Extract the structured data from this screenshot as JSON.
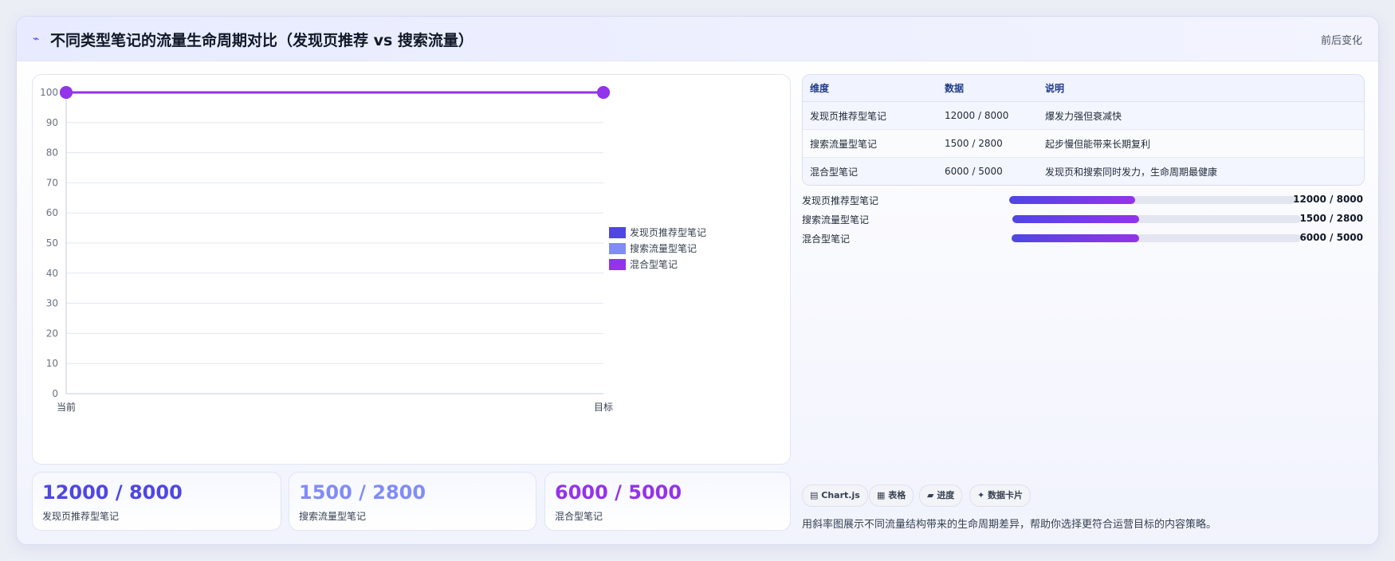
{
  "header": {
    "icon": "⌁",
    "title": "不同类型笔记的流量生命周期对比（发现页推荐 vs 搜索流量）",
    "right_label": "前后变化"
  },
  "chart_data": {
    "type": "line",
    "title": "",
    "x": [
      "当前",
      "目标"
    ],
    "ylim": [
      0,
      100
    ],
    "yticks": [
      0,
      10,
      20,
      30,
      40,
      50,
      60,
      70,
      80,
      90,
      100
    ],
    "series": [
      {
        "name": "发现页推荐型笔记",
        "values": [
          100,
          100
        ],
        "color": "#4f46e5"
      },
      {
        "name": "搜索流量型笔记",
        "values": [
          100,
          100
        ],
        "color": "#818cf8"
      },
      {
        "name": "混合型笔记",
        "values": [
          100,
          100
        ],
        "color": "#9333ea"
      }
    ],
    "legend_position": "right",
    "grid": true
  },
  "stats": [
    {
      "value": "12000 / 8000",
      "label": "发现页推荐型笔记",
      "color": "#4f46e5"
    },
    {
      "value": "1500 / 2800",
      "label": "搜索流量型笔记",
      "color": "#818cf8"
    },
    {
      "value": "6000 / 5000",
      "label": "混合型笔记",
      "color": "#9333ea"
    }
  ],
  "table": {
    "headers": [
      "维度",
      "数据",
      "说明"
    ],
    "rows": [
      [
        "发现页推荐型笔记",
        "12000 / 8000",
        "爆发力强但衰减快"
      ],
      [
        "搜索流量型笔记",
        "1500 / 2800",
        "起步慢但能带来长期复利"
      ],
      [
        "混合型笔记",
        "6000 / 5000",
        "发现页和搜索同时发力，生命周期最健康"
      ]
    ]
  },
  "progress": [
    {
      "label": "发现页推荐型笔记",
      "value": "12000 / 8000",
      "fraction": 0.44
    },
    {
      "label": "搜索流量型笔记",
      "value": "1500 / 2800",
      "fraction": 0.44
    },
    {
      "label": "混合型笔记",
      "value": "6000 / 5000",
      "fraction": 0.44
    }
  ],
  "chips": [
    {
      "icon": "chart-icon",
      "glyph": "▤",
      "label": "Chart.js"
    },
    {
      "icon": "table-icon",
      "glyph": "▦",
      "label": "表格"
    },
    {
      "icon": "progress-icon",
      "glyph": "▰",
      "label": "进度"
    },
    {
      "icon": "card-icon",
      "glyph": "✦",
      "label": "数据卡片"
    }
  ],
  "note": "用斜率图展示不同流量结构带来的生命周期差异，帮助你选择更符合运营目标的内容策略。"
}
